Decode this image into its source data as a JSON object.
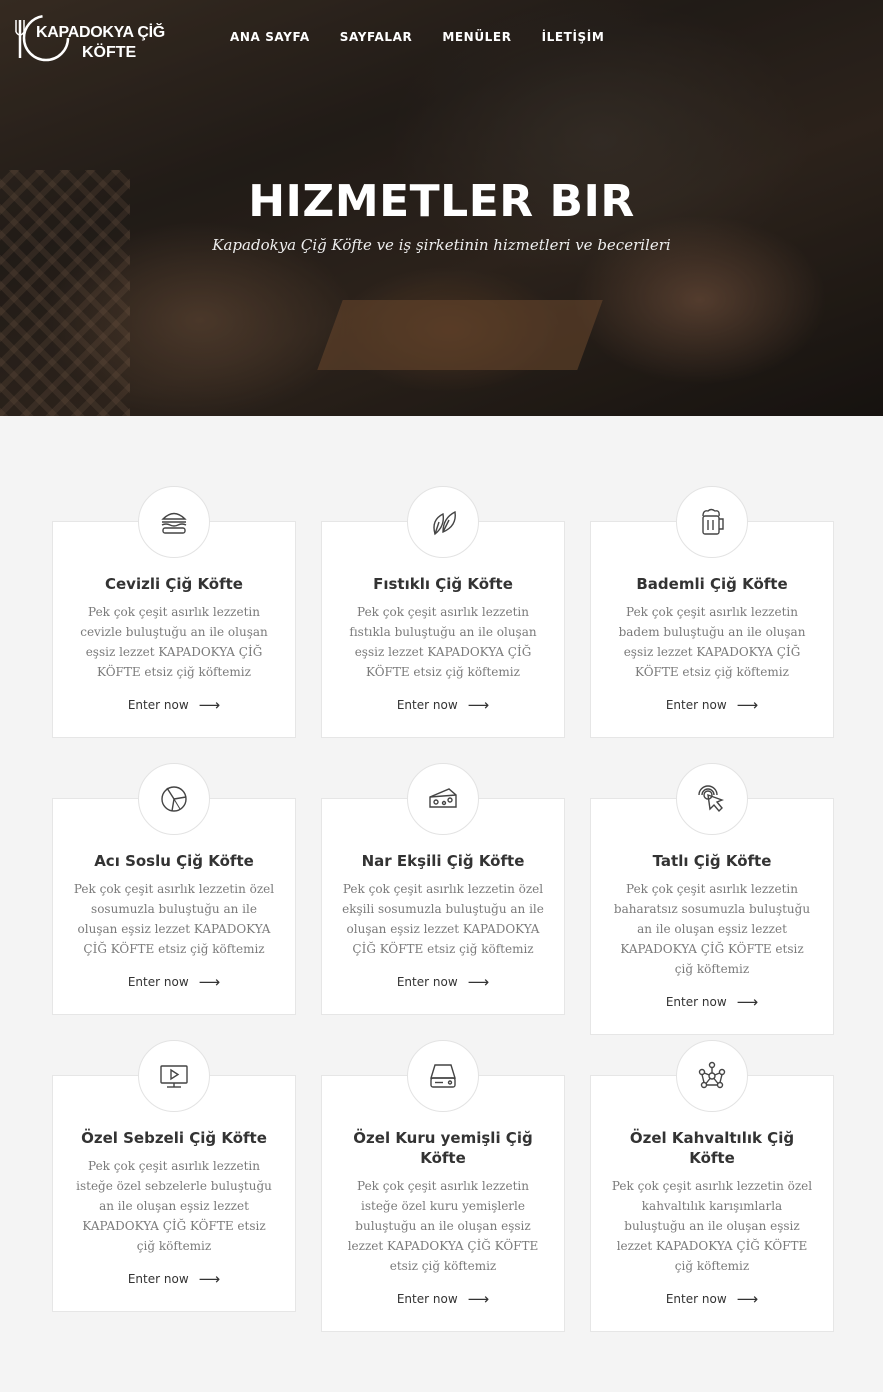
{
  "logo": {
    "line1": "KAPADOKYA ÇİĞ",
    "line2": "KÖFTE"
  },
  "nav": [
    {
      "label": "ANA SAYFA"
    },
    {
      "label": "SAYFALAR"
    },
    {
      "label": "MENÜLER"
    },
    {
      "label": "İLETİŞİM"
    }
  ],
  "hero": {
    "title": "HIZMETLER BIR",
    "subtitle": "Kapadokya Çiğ Köfte ve iş şirketinin hizmetleri ve becerileri"
  },
  "cards": [
    {
      "icon": "burger-icon",
      "title": "Cevizli Çiğ Köfte",
      "text": "Pek çok çeşit asırlık lezzetin cevizle buluştuğu an ile oluşan eşsiz lezzet KAPADOKYA ÇİĞ KÖFTE etsiz çiğ köftemiz",
      "link": "Enter now"
    },
    {
      "icon": "leaf-icon",
      "title": "Fıstıklı Çiğ Köfte",
      "text": "Pek çok çeşit asırlık lezzetin fıstıkla buluştuğu an ile oluşan eşsiz lezzet KAPADOKYA ÇİĞ KÖFTE etsiz çiğ köftemiz",
      "link": "Enter now"
    },
    {
      "icon": "beer-mug-icon",
      "title": "Bademli Çiğ Köfte",
      "text": "Pek çok çeşit asırlık lezzetin badem buluştuğu an ile oluşan eşsiz lezzet KAPADOKYA ÇİĞ KÖFTE etsiz çiğ köftemiz",
      "link": "Enter now"
    },
    {
      "icon": "pizza-icon",
      "title": "Acı Soslu Çiğ Köfte",
      "text": "Pek çok çeşit asırlık lezzetin özel sosumuzla buluştuğu an ile oluşan eşsiz lezzet KAPADOKYA ÇİĞ KÖFTE etsiz çiğ köftemiz",
      "link": "Enter now"
    },
    {
      "icon": "cheese-icon",
      "title": "Nar Ekşili Çiğ Köfte",
      "text": "Pek çok çeşit asırlık lezzetin özel ekşili sosumuzla buluştuğu an ile oluşan eşsiz lezzet KAPADOKYA ÇİĞ KÖFTE etsiz çiğ köftemiz",
      "link": "Enter now"
    },
    {
      "icon": "pointer-click-icon",
      "title": "Tatlı Çiğ Köfte",
      "text": "Pek çok çeşit asırlık lezzetin baharatsız sosumuzla buluştuğu an ile oluşan eşsiz lezzet KAPADOKYA ÇİĞ KÖFTE etsiz çiğ köftemiz",
      "link": "Enter now"
    },
    {
      "icon": "monitor-play-icon",
      "title": "Özel Sebzeli Çiğ Köfte",
      "text": "Pek çok çeşit asırlık lezzetin isteğe özel sebzelerle buluştuğu an ile oluşan eşsiz lezzet KAPADOKYA ÇİĞ KÖFTE etsiz çiğ köftemiz",
      "link": "Enter now"
    },
    {
      "icon": "hard-drive-icon",
      "title": "Özel Kuru yemişli Çiğ Köfte",
      "text": "Pek çok çeşit asırlık lezzetin isteğe özel kuru yemişlerle buluştuğu an ile oluşan eşsiz lezzet KAPADOKYA ÇİĞ KÖFTE etsiz çiğ köftemiz",
      "link": "Enter now"
    },
    {
      "icon": "network-nodes-icon",
      "title": "Özel Kahvaltılık Çiğ Köfte",
      "text": "Pek çok çeşit asırlık lezzetin özel kahvaltılık karışımlarla buluştuğu an ile oluşan eşsiz lezzet KAPADOKYA ÇİĞ KÖFTE çiğ köftemiz",
      "link": "Enter now"
    }
  ]
}
